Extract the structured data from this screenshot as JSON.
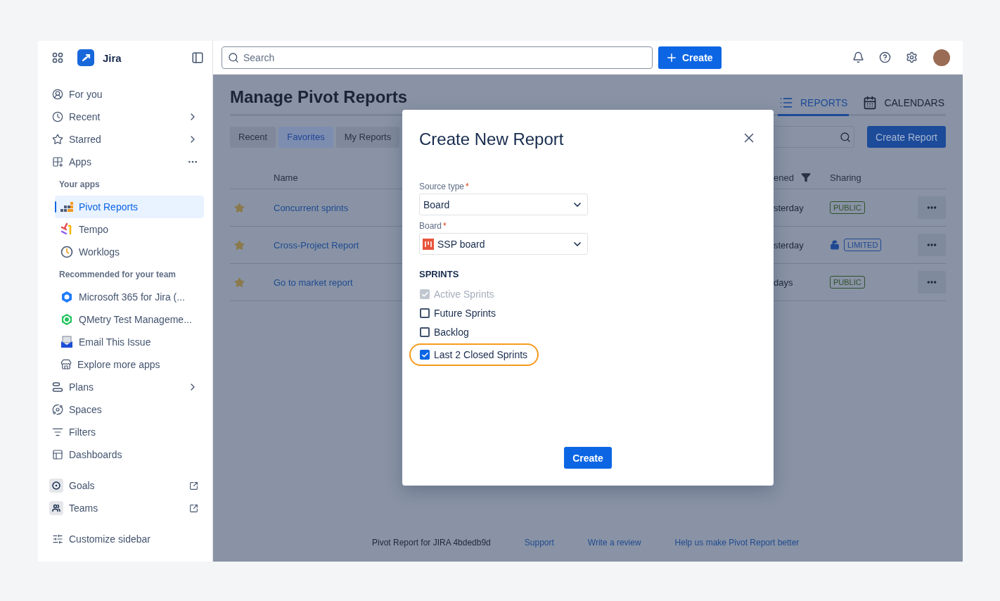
{
  "sidebar": {
    "app_name": "Jira",
    "groups": [
      [
        {
          "kind": "nav",
          "label": "For you"
        },
        {
          "kind": "nav",
          "label": "Recent",
          "chevron": true
        },
        {
          "kind": "nav",
          "label": "Starred",
          "chevron": true
        },
        {
          "kind": "nav",
          "label": "Apps",
          "more": true
        },
        {
          "kind": "heading",
          "label": "Your apps"
        },
        {
          "kind": "app",
          "label": "Pivot Reports",
          "selected": true
        },
        {
          "kind": "app",
          "label": "Tempo",
          "selected": false
        },
        {
          "kind": "app",
          "label": "Worklogs",
          "selected": false
        },
        {
          "kind": "heading",
          "label": "Recommended for your team"
        },
        {
          "kind": "app",
          "label": "Microsoft 365 for Jira (...",
          "selected": false
        },
        {
          "kind": "app",
          "label": "QMetry Test Manageme...",
          "selected": false
        },
        {
          "kind": "app",
          "label": "Email This Issue",
          "selected": false
        },
        {
          "kind": "app",
          "label": "Explore more apps",
          "selected": false
        },
        {
          "kind": "nav",
          "label": "Plans",
          "chevron": true
        },
        {
          "kind": "nav",
          "label": "Spaces"
        },
        {
          "kind": "nav",
          "label": "Filters"
        },
        {
          "kind": "nav",
          "label": "Dashboards"
        }
      ],
      [
        {
          "kind": "tile",
          "label": "Goals",
          "external": true
        },
        {
          "kind": "tile",
          "label": "Teams",
          "external": true
        }
      ],
      [
        {
          "kind": "nav",
          "label": "Customize sidebar"
        }
      ]
    ]
  },
  "topbar": {
    "search": {
      "placeholder": "Search"
    },
    "create_label": "Create"
  },
  "page": {
    "title": "Manage Pivot Reports",
    "view_tabs": [
      {
        "label": "REPORTS",
        "selected": true
      },
      {
        "label": "CALENDARS",
        "selected": false
      }
    ],
    "filter_tabs": [
      {
        "label": "Recent",
        "selected": false
      },
      {
        "label": "Favorites",
        "selected": true
      },
      {
        "label": "My Reports",
        "selected": false
      }
    ],
    "create_report": "Create Report",
    "table": {
      "columns": [
        "Name",
        "ened",
        "Sharing"
      ],
      "rows": [
        {
          "name": "Concurrent sprints",
          "starred": true,
          "last_opened": "sterday",
          "locked": false,
          "sharing": {
            "label": "PUBLIC",
            "color": "#31512c"
          }
        },
        {
          "name": "Cross-Project Report",
          "starred": true,
          "last_opened": "sterday",
          "locked": true,
          "sharing": {
            "label": "LIMITED",
            "color": "#1f4893"
          }
        },
        {
          "name": "Go to market report",
          "starred": true,
          "last_opened": "days",
          "locked": false,
          "sharing": {
            "label": "PUBLIC",
            "color": "#31512c"
          }
        }
      ]
    },
    "footer": [
      {
        "kind": "text",
        "text": "Pivot Report for JIRA 4bdedb9d"
      },
      {
        "kind": "link",
        "text": "Support"
      },
      {
        "kind": "link",
        "text": "Write a review"
      },
      {
        "kind": "link",
        "text": "Help us make Pivot Report better"
      }
    ]
  },
  "dialog": {
    "title": "Create New Report",
    "fields": [
      {
        "kind": "select",
        "label": "Source type",
        "required_mark": "*",
        "value": "Board"
      },
      {
        "kind": "board-select",
        "label": "Board",
        "required_mark": "*",
        "value": "SSP board"
      }
    ],
    "sprints": {
      "heading": "SPRINTS",
      "options": [
        {
          "label": "Active Sprints",
          "checked": true,
          "disabled": true,
          "highlighted": false
        },
        {
          "label": "Future Sprints",
          "checked": false,
          "disabled": false,
          "highlighted": false
        },
        {
          "label": "Backlog",
          "checked": false,
          "disabled": false,
          "highlighted": false
        },
        {
          "label": "Last 2 Closed Sprints",
          "checked": true,
          "disabled": false,
          "highlighted": true
        }
      ]
    },
    "create_label": "Create"
  }
}
